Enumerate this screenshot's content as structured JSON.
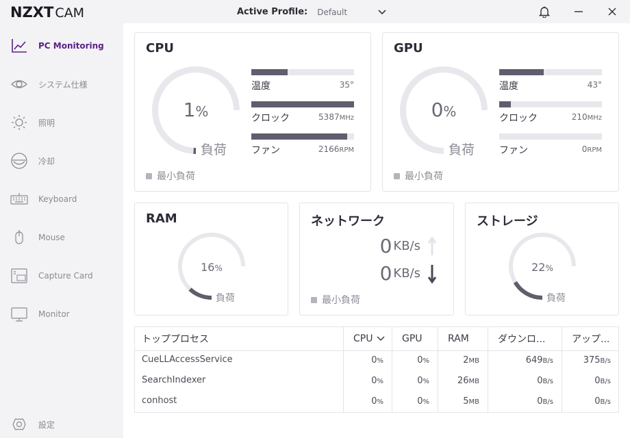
{
  "app": {
    "logo_main": "NZXT",
    "logo_sub": "CAM"
  },
  "header": {
    "profile_label": "Active Profile:",
    "profile_value": "Default"
  },
  "sidebar": {
    "items": [
      {
        "label": "PC Monitoring",
        "icon": "chart-line-icon",
        "active": true
      },
      {
        "label": "システム仕様",
        "icon": "eye-icon"
      },
      {
        "label": "照明",
        "icon": "sun-icon"
      },
      {
        "label": "冷却",
        "icon": "fan-icon"
      },
      {
        "label": "Keyboard",
        "icon": "keyboard-icon"
      },
      {
        "label": "Mouse",
        "icon": "mouse-icon"
      },
      {
        "label": "Capture Card",
        "icon": "capture-card-icon"
      },
      {
        "label": "Monitor",
        "icon": "monitor-icon"
      }
    ],
    "settings_label": "設定"
  },
  "cpu": {
    "title": "CPU",
    "load_value": "1",
    "load_unit": "%",
    "load_fraction": 0.01,
    "load_label": "負荷",
    "bars": [
      {
        "label": "温度",
        "value": "35°",
        "fill": 0.35
      },
      {
        "label": "クロック",
        "value": "5387",
        "unit": "MHz",
        "fill": 1.0
      },
      {
        "label": "ファン",
        "value": "2166",
        "unit": "RPM",
        "fill": 0.93
      }
    ],
    "legend": "最小負荷"
  },
  "gpu": {
    "title": "GPU",
    "load_value": "0",
    "load_unit": "%",
    "load_fraction": 0.0,
    "load_label": "負荷",
    "bars": [
      {
        "label": "温度",
        "value": "43°",
        "fill": 0.43
      },
      {
        "label": "クロック",
        "value": "210",
        "unit": "MHz",
        "fill": 0.11
      },
      {
        "label": "ファン",
        "value": "0",
        "unit": "RPM",
        "fill": 0.0
      }
    ],
    "legend": "最小負荷"
  },
  "ram": {
    "title": "RAM",
    "load_value": "16",
    "load_unit": "%",
    "load_fraction": 0.16,
    "load_label": "負荷"
  },
  "network": {
    "title": "ネットワーク",
    "down_value": "0",
    "down_unit": "KB/s",
    "up_value": "0",
    "up_unit": "KB/s",
    "legend": "最小負荷"
  },
  "storage": {
    "title": "ストレージ",
    "load_value": "22",
    "load_unit": "%",
    "load_fraction": 0.22,
    "load_label": "負荷"
  },
  "processes": {
    "headers": [
      "トッププロセス",
      "CPU",
      "GPU",
      "RAM",
      "ダウンロ...",
      "アップ..."
    ],
    "rows": [
      {
        "name": "CueLLAccessService",
        "cpu": "0",
        "gpu": "0",
        "ram": "2",
        "down": "649",
        "up": "375"
      },
      {
        "name": "SearchIndexer",
        "cpu": "0",
        "gpu": "0",
        "ram": "26",
        "down": "0",
        "up": "0"
      },
      {
        "name": "conhost",
        "cpu": "0",
        "gpu": "0",
        "ram": "5",
        "down": "0",
        "up": "0"
      }
    ],
    "units": {
      "pct": "%",
      "ram": "MB",
      "rate": "B/s"
    }
  },
  "colors": {
    "accent": "#5a1f86",
    "bar_fill": "#5e5e6e",
    "gauge_track": "#e8e8ec",
    "gauge_fill": "#5e5e6e"
  }
}
